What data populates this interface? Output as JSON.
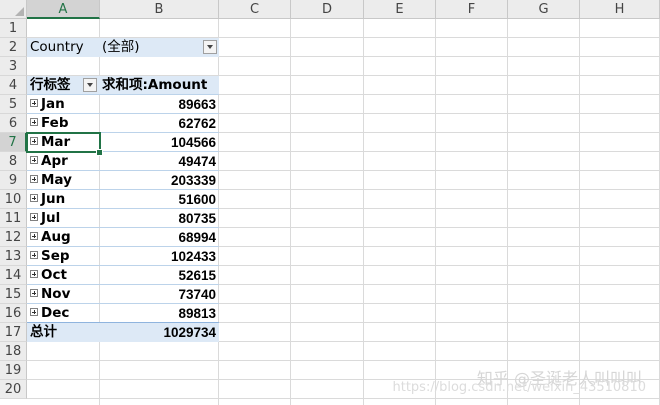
{
  "columns": [
    "A",
    "B",
    "C",
    "D",
    "E",
    "F",
    "G",
    "H"
  ],
  "rows": [
    "1",
    "2",
    "3",
    "4",
    "5",
    "6",
    "7",
    "8",
    "9",
    "10",
    "11",
    "12",
    "13",
    "14",
    "15",
    "16",
    "17",
    "18",
    "19",
    "20"
  ],
  "filter": {
    "label": "Country",
    "value": "(全部)"
  },
  "pivot": {
    "row_label_header": "行标签",
    "value_header": "求和项:Amount",
    "items": [
      {
        "label": "Jan",
        "value": "89663"
      },
      {
        "label": "Feb",
        "value": "62762"
      },
      {
        "label": "Mar",
        "value": "104566"
      },
      {
        "label": "Apr",
        "value": "49474"
      },
      {
        "label": "May",
        "value": "203339"
      },
      {
        "label": "Jun",
        "value": "51600"
      },
      {
        "label": "Jul",
        "value": "80735"
      },
      {
        "label": "Aug",
        "value": "68994"
      },
      {
        "label": "Sep",
        "value": "102433"
      },
      {
        "label": "Oct",
        "value": "52615"
      },
      {
        "label": "Nov",
        "value": "73740"
      },
      {
        "label": "Dec",
        "value": "89813"
      }
    ],
    "total_label": "总计",
    "total_value": "1029734"
  },
  "selection": {
    "column": "A",
    "row": "7"
  },
  "watermark": "知乎 @圣诞老人叫叫叫",
  "watermark_url": "https://blog.csdn.net/weixin_43510810"
}
